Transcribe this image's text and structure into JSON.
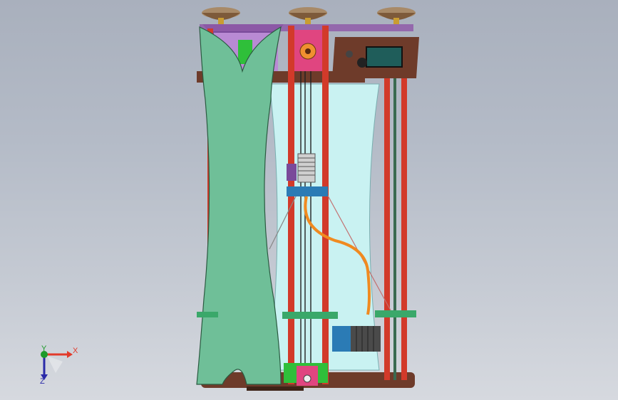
{
  "viewport": {
    "background_top": "#a9b0bd",
    "background_bottom": "#d6d9df"
  },
  "model": {
    "description_icon": "delta-3d-printer-assembly",
    "colors": {
      "frame_red": "#d23a2a",
      "panel_green": "#6fbf98",
      "glass_cyan": "#c9f2f2",
      "brown_plate": "#6e3b2a",
      "purple_plate": "#7a4a9a",
      "filament_orange": "#f08a20",
      "motor_blue": "#2b7bb5"
    }
  },
  "triad": {
    "x_label": "X",
    "y_label": "Y",
    "z_label": "Z",
    "x_color": "#e23a2a",
    "y_color": "#1d9a2a",
    "z_color": "#2a2aa8"
  }
}
